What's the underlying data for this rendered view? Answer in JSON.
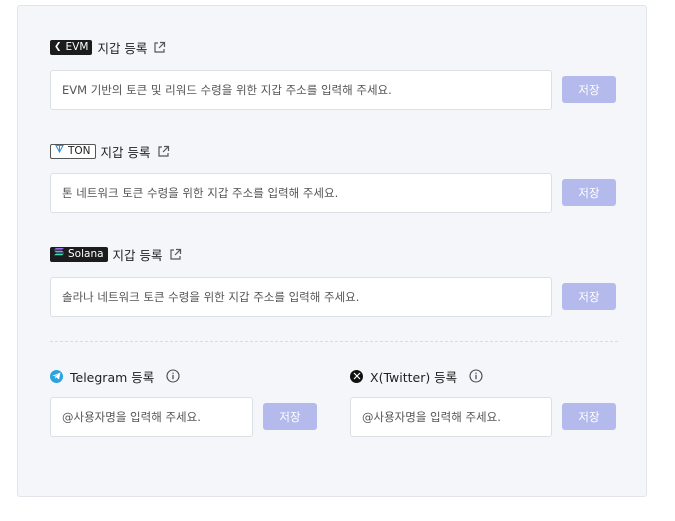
{
  "wallets": [
    {
      "chain_badge": "EVM",
      "label": "지갑 등록",
      "placeholder": "EVM 기반의 토큰 및 리워드 수령을 위한 지갑 주소를 입력해 주세요.",
      "save_label": "저장"
    },
    {
      "chain_badge": "TON",
      "label": "지갑 등록",
      "placeholder": "톤 네트워크 토큰 수령을 위한 지갑 주소를 입력해 주세요.",
      "save_label": "저장"
    },
    {
      "chain_badge": "Solana",
      "label": "지갑 등록",
      "placeholder": "솔라나 네트워크 토큰 수령을 위한 지갑 주소를 입력해 주세요.",
      "save_label": "저장"
    }
  ],
  "socials": [
    {
      "label": "Telegram 등록",
      "placeholder": "@사용자명을 입력해 주세요.",
      "save_label": "저장"
    },
    {
      "label": "X(Twitter) 등록",
      "placeholder": "@사용자명을 입력해 주세요.",
      "save_label": "저장"
    }
  ],
  "colors": {
    "save_button": "#b4bbec",
    "panel_bg": "#f4f6f9",
    "telegram": "#2aa3df",
    "x_brand": "#111111"
  }
}
